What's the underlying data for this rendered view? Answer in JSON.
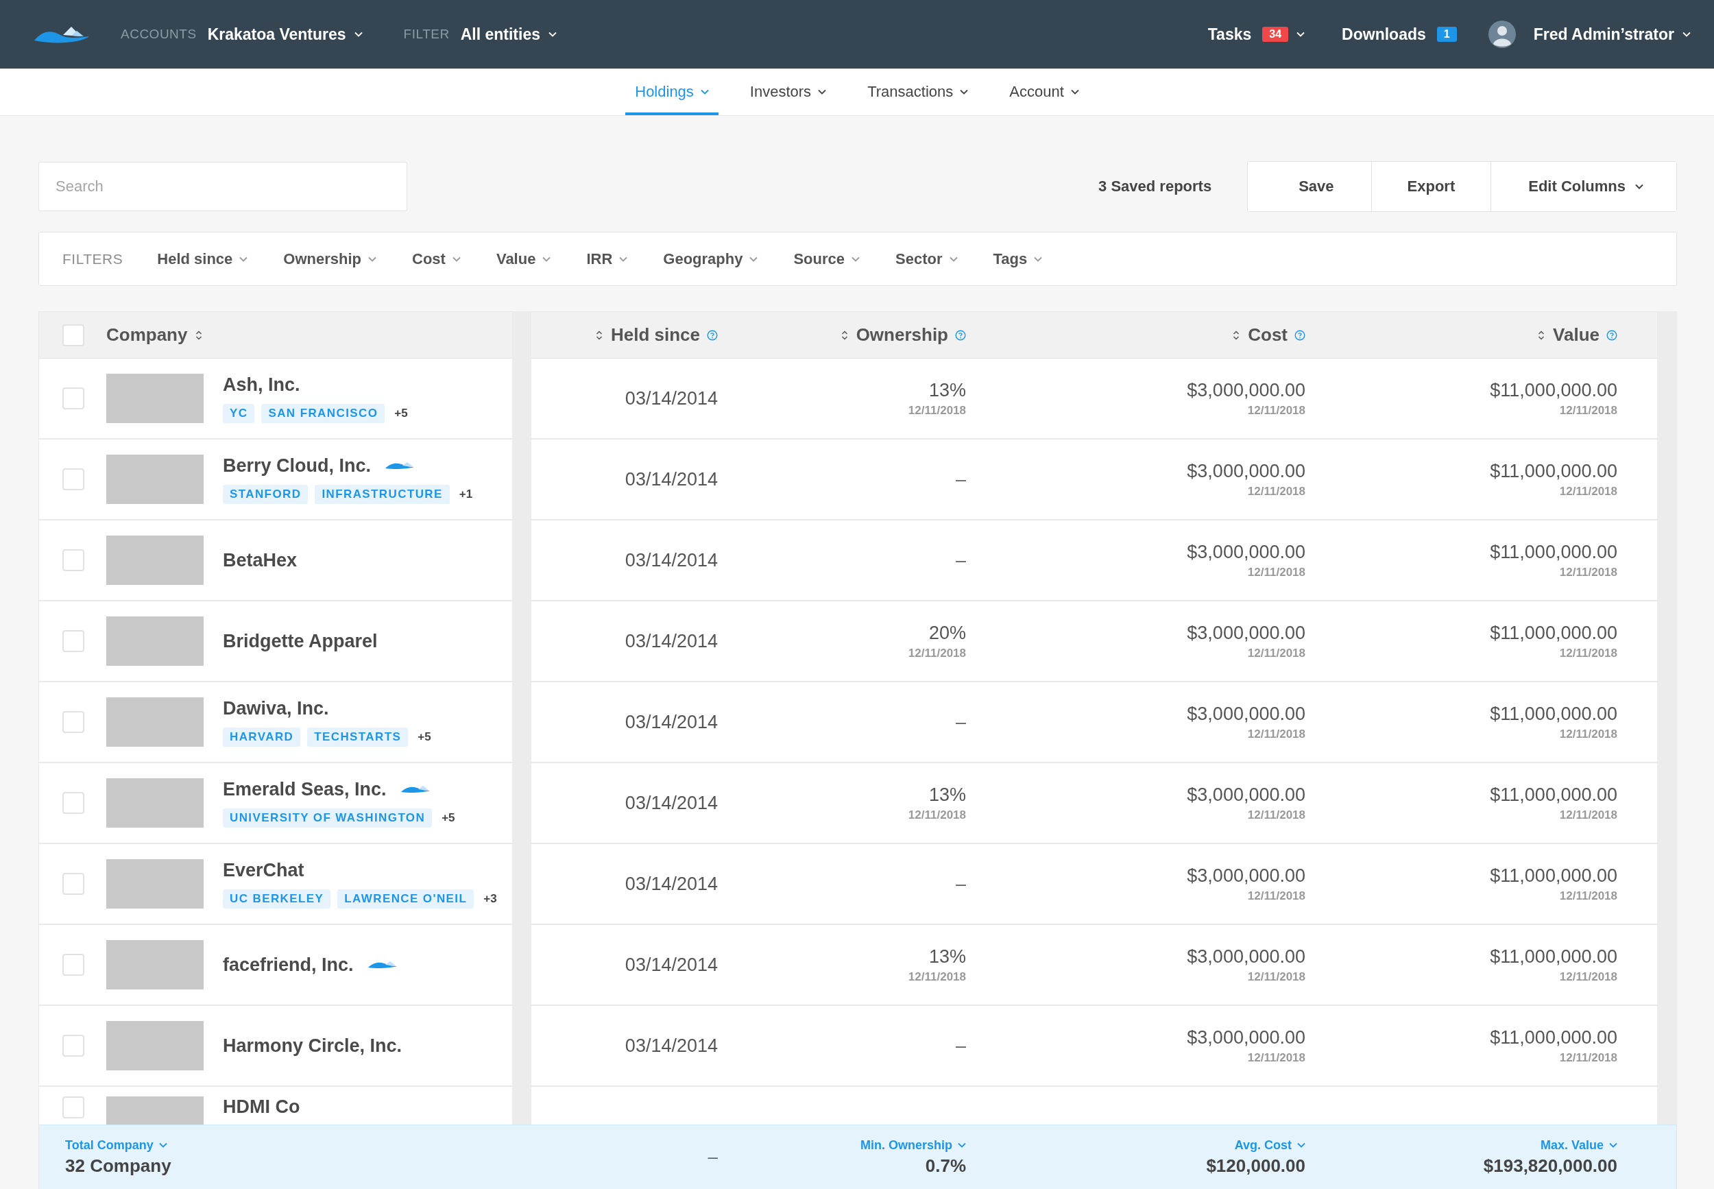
{
  "top_bar": {
    "accounts_label": "ACCOUNTS",
    "account": "Krakatoa Ventures",
    "filter_label": "FILTER",
    "filter": "All entities",
    "tasks": {
      "label": "Tasks",
      "count": "34"
    },
    "downloads": {
      "label": "Downloads",
      "count": "1"
    },
    "user": "Fred Admin’strator"
  },
  "nav_tabs": [
    {
      "label": "Holdings",
      "selected": true
    },
    {
      "label": "Investors",
      "selected": false
    },
    {
      "label": "Transactions",
      "selected": false
    },
    {
      "label": "Account",
      "selected": false
    }
  ],
  "search": {
    "placeholder": "Search"
  },
  "saved_reports": "3 Saved reports",
  "actions": [
    {
      "label": "Save",
      "dropdown": false
    },
    {
      "label": "Export",
      "dropdown": false
    },
    {
      "label": "Edit Columns",
      "dropdown": true
    }
  ],
  "filters": {
    "label": "FILTERS",
    "items": [
      "Held since",
      "Ownership",
      "Cost",
      "Value",
      "IRR",
      "Geography",
      "Source",
      "Sector",
      "Tags"
    ]
  },
  "table": {
    "all_checked": false,
    "columns": [
      "Company",
      "Held since",
      "Ownership",
      "Cost",
      "Value"
    ],
    "rows": [
      {
        "name": "Ash, Inc.",
        "fund_mark": false,
        "tags": [
          {
            "label": "YC",
            "kind": "tag"
          },
          {
            "label": "SAN FRANCISCO",
            "kind": "tag"
          },
          {
            "label": "+5",
            "kind": "count"
          }
        ],
        "checked": false,
        "held_since": "03/14/2014",
        "ownership": "13%",
        "ownership_date": "12/11/2018",
        "cost": "$3,000,000.00",
        "cost_date": "12/11/2018",
        "value": "$11,000,000.00",
        "value_date": "12/11/2018"
      },
      {
        "name": "Berry Cloud, Inc.",
        "fund_mark": true,
        "tags": [
          {
            "label": "STANFORD",
            "kind": "tag"
          },
          {
            "label": "INFRASTRUCTURE",
            "kind": "tag"
          },
          {
            "label": "+1",
            "kind": "count"
          }
        ],
        "checked": false,
        "held_since": "03/14/2014",
        "ownership": "–",
        "cost": "$3,000,000.00",
        "cost_date": "12/11/2018",
        "value": "$11,000,000.00",
        "value_date": "12/11/2018"
      },
      {
        "name": "BetaHex",
        "fund_mark": false,
        "checked": false,
        "held_since": "03/14/2014",
        "ownership": "–",
        "cost": "$3,000,000.00",
        "cost_date": "12/11/2018",
        "value": "$11,000,000.00",
        "value_date": "12/11/2018"
      },
      {
        "name": "Bridgette Apparel",
        "fund_mark": false,
        "checked": false,
        "held_since": "03/14/2014",
        "ownership": "20%",
        "ownership_date": "12/11/2018",
        "cost": "$3,000,000.00",
        "cost_date": "12/11/2018",
        "value": "$11,000,000.00",
        "value_date": "12/11/2018"
      },
      {
        "name": "Dawiva, Inc.",
        "fund_mark": false,
        "tags": [
          {
            "label": "HARVARD",
            "kind": "tag"
          },
          {
            "label": "TECHSTARTS",
            "kind": "tag"
          },
          {
            "label": "+5",
            "kind": "count"
          }
        ],
        "checked": false,
        "held_since": "03/14/2014",
        "ownership": "–",
        "cost": "$3,000,000.00",
        "cost_date": "12/11/2018",
        "value": "$11,000,000.00",
        "value_date": "12/11/2018"
      },
      {
        "name": "Emerald Seas, Inc.",
        "fund_mark": true,
        "tags": [
          {
            "label": "UNIVERSITY OF WASHINGTON",
            "kind": "tag"
          },
          {
            "label": "+5",
            "kind": "count"
          }
        ],
        "checked": false,
        "held_since": "03/14/2014",
        "ownership": "13%",
        "ownership_date": "12/11/2018",
        "cost": "$3,000,000.00",
        "cost_date": "12/11/2018",
        "value": "$11,000,000.00",
        "value_date": "12/11/2018"
      },
      {
        "name": "EverChat",
        "fund_mark": false,
        "tags": [
          {
            "label": "UC BERKELEY",
            "kind": "tag"
          },
          {
            "label": "LAWRENCE O'NEIL",
            "kind": "tag"
          },
          {
            "label": "+3",
            "kind": "count"
          }
        ],
        "checked": false,
        "held_since": "03/14/2014",
        "ownership": "–",
        "cost": "$3,000,000.00",
        "cost_date": "12/11/2018",
        "value": "$11,000,000.00",
        "value_date": "12/11/2018"
      },
      {
        "name": "facefriend, Inc.",
        "fund_mark": true,
        "checked": false,
        "held_since": "03/14/2014",
        "ownership": "13%",
        "ownership_date": "12/11/2018",
        "cost": "$3,000,000.00",
        "cost_date": "12/11/2018",
        "value": "$11,000,000.00",
        "value_date": "12/11/2018"
      },
      {
        "name": "Harmony Circle, Inc.",
        "fund_mark": false,
        "checked": false,
        "held_since": "03/14/2014",
        "ownership": "–",
        "cost": "$3,000,000.00",
        "cost_date": "12/11/2018",
        "value": "$11,000,000.00",
        "value_date": "12/11/2018"
      },
      {
        "name": "HDMI Co",
        "fund_mark": false,
        "checked": false
      }
    ],
    "footer": [
      {
        "label": "Total Company",
        "value": "32 Company"
      },
      {
        "value": "–"
      },
      {
        "label": "Min. Ownership",
        "value": "0.7%"
      },
      {
        "label": "Avg. Cost",
        "value": "$120,000.00"
      },
      {
        "label": "Max. Value",
        "value": "$193,820,000.00"
      }
    ]
  }
}
